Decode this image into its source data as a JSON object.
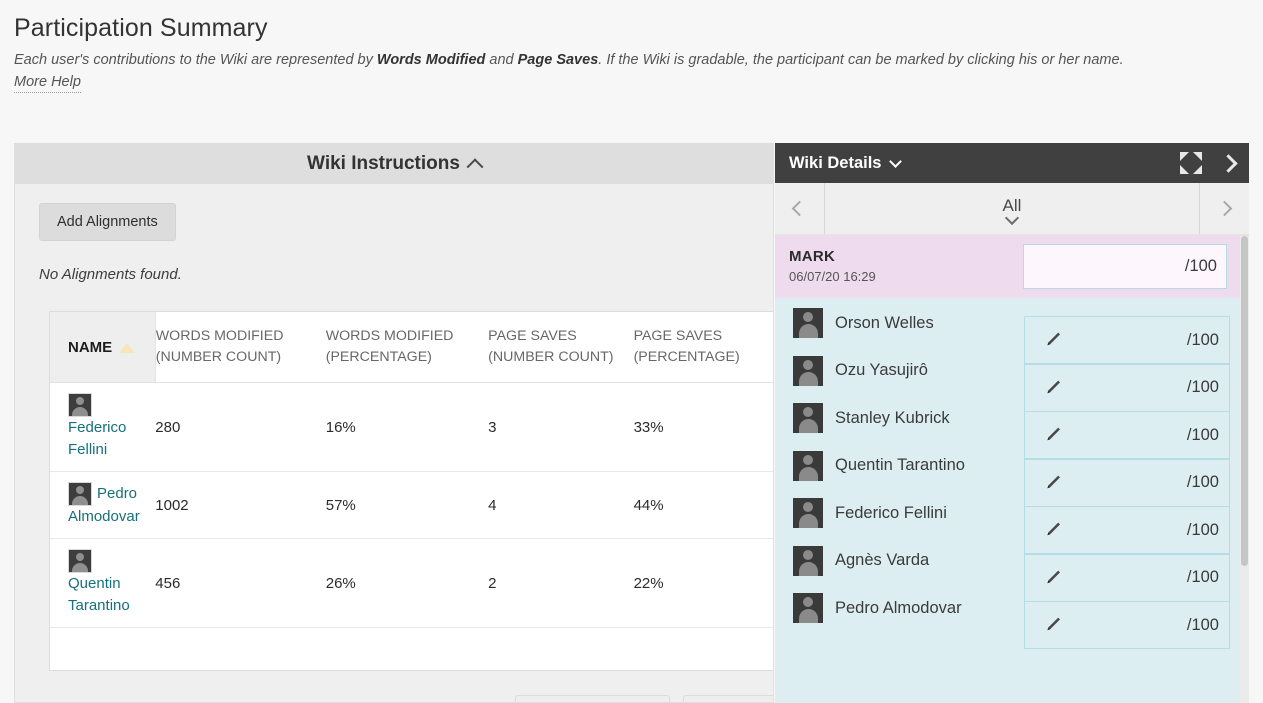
{
  "page": {
    "title": "Participation Summary",
    "description_part1": "Each user's contributions to the Wiki are represented by ",
    "description_bold1": "Words Modified",
    "description_part2": " and ",
    "description_bold2": "Page Saves",
    "description_part3": ". If the Wiki is gradable, the participant can be marked by clicking his or her name.",
    "more_help": "More Help"
  },
  "instructions_panel": {
    "title": "Wiki Instructions",
    "collapse_icon": "chevron-up-icon",
    "add_alignments_label": "Add Alignments",
    "no_alignments_text": "No Alignments found."
  },
  "participation_table": {
    "columns": [
      "NAME",
      "WORDS MODIFIED (NUMBER COUNT)",
      "WORDS MODIFIED (PERCENTAGE)",
      "PAGE SAVES (NUMBER COUNT)",
      "PAGE SAVES (PERCENTAGE)"
    ],
    "sort_column": "NAME",
    "sort_direction": "ascending",
    "rows": [
      {
        "name": "Federico Fellini",
        "words_modified_count": "280",
        "words_modified_pct": "16%",
        "page_saves_count": "3",
        "page_saves_pct": "33%"
      },
      {
        "name": "Pedro Almodovar",
        "words_modified_count": "1002",
        "words_modified_pct": "57%",
        "page_saves_count": "4",
        "page_saves_pct": "44%"
      },
      {
        "name": "Quentin Tarantino",
        "words_modified_count": "456",
        "words_modified_pct": "26%",
        "page_saves_count": "2",
        "page_saves_pct": "22%"
      }
    ]
  },
  "details_panel": {
    "title": "Wiki Details",
    "title_caret_icon": "chevron-down-icon",
    "expand_icon": "expand-arrows-icon",
    "next_icon": "chevron-right-icon",
    "nav": {
      "prev_icon": "chevron-left-icon",
      "label": "All",
      "caret_icon": "chevron-down-icon",
      "next_icon": "chevron-right-icon"
    },
    "mark": {
      "label": "MARK",
      "date": "06/07/20 16:29",
      "value": "",
      "max": "/100"
    },
    "students": [
      {
        "name": "Orson Welles",
        "grade_value": "",
        "grade_max": "/100",
        "edit_icon": "pencil-icon"
      },
      {
        "name": "Ozu Yasujirô",
        "grade_value": "",
        "grade_max": "/100",
        "edit_icon": "pencil-icon"
      },
      {
        "name": "Stanley Kubrick",
        "grade_value": "",
        "grade_max": "/100",
        "edit_icon": "pencil-icon"
      },
      {
        "name": "Quentin Tarantino",
        "grade_value": "",
        "grade_max": "/100",
        "edit_icon": "pencil-icon"
      },
      {
        "name": "Federico Fellini",
        "grade_value": "",
        "grade_max": "/100",
        "edit_icon": "pencil-icon"
      },
      {
        "name": "Agnès Varda",
        "grade_value": "",
        "grade_max": "/100",
        "edit_icon": "pencil-icon"
      },
      {
        "name": "Pedro Almodovar",
        "grade_value": "",
        "grade_max": "/100",
        "edit_icon": "pencil-icon"
      }
    ]
  },
  "colors": {
    "page_background": "#f7f7f7",
    "panel_header": "#dedede",
    "panel_body": "#efefef",
    "details_header": "#404040",
    "mark_background": "#eedcee",
    "student_list_background": "#ddeef2",
    "link_teal": "#16707b",
    "sort_triangle": "#f5e6bd",
    "grade_border": "#b6dce5"
  }
}
